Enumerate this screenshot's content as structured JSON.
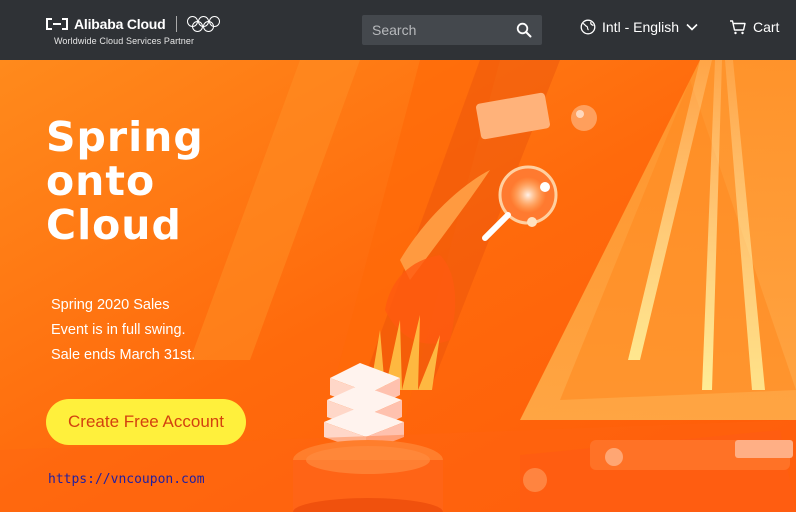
{
  "header": {
    "brand": "Alibaba Cloud",
    "tagline": "Worldwide Cloud Services Partner",
    "search": {
      "placeholder": "Search",
      "value": ""
    },
    "language_label": "Intl - English",
    "cart_label": "Cart",
    "icons": [
      "alibaba-cloud-logo",
      "olympic-rings",
      "search-icon",
      "globe-icon",
      "chevron-down-icon",
      "cart-icon"
    ]
  },
  "hero": {
    "headline": [
      "Spring",
      "onto",
      "Cloud"
    ],
    "description": [
      "Spring 2020 Sales",
      "Event is in full swing.",
      "Sale ends March 31st."
    ],
    "cta_label": "Create Free Account",
    "watermark": "https://vncoupon.com"
  },
  "colors": {
    "header_bg": "#2f3236",
    "hero_orange": "#ff7a10",
    "cta_yellow": "#fff03c",
    "cta_text": "#d3410f"
  }
}
